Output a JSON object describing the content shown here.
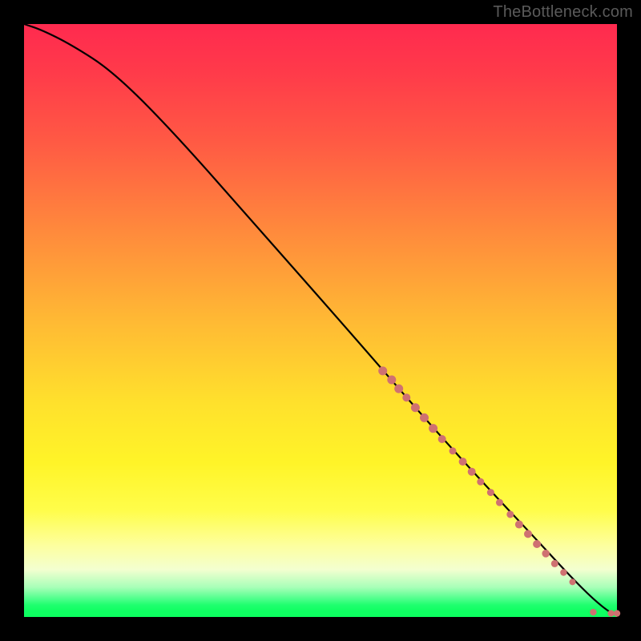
{
  "attribution": "TheBottleneck.com",
  "chart_data": {
    "type": "line",
    "title": "",
    "xlabel": "",
    "ylabel": "",
    "xlim": [
      0,
      100
    ],
    "ylim": [
      0,
      100
    ],
    "line": {
      "x": [
        0,
        3,
        8,
        15,
        25,
        40,
        55,
        68,
        78,
        86,
        92,
        96,
        99,
        100
      ],
      "y": [
        100,
        99,
        96.5,
        92,
        82,
        65,
        48,
        33,
        22,
        13.5,
        7,
        3,
        0.6,
        0.6
      ]
    },
    "markers": [
      {
        "x": 60.5,
        "y": 41.5,
        "r": 5.5
      },
      {
        "x": 62.0,
        "y": 40.0,
        "r": 5.5
      },
      {
        "x": 63.2,
        "y": 38.5,
        "r": 5.5
      },
      {
        "x": 64.5,
        "y": 37.0,
        "r": 5.0
      },
      {
        "x": 66.0,
        "y": 35.3,
        "r": 5.5
      },
      {
        "x": 67.5,
        "y": 33.6,
        "r": 5.5
      },
      {
        "x": 69.0,
        "y": 31.8,
        "r": 5.5
      },
      {
        "x": 70.5,
        "y": 30.0,
        "r": 5.0
      },
      {
        "x": 72.3,
        "y": 28.0,
        "r": 4.5
      },
      {
        "x": 74.0,
        "y": 26.2,
        "r": 5.0
      },
      {
        "x": 75.5,
        "y": 24.5,
        "r": 5.0
      },
      {
        "x": 77.0,
        "y": 22.8,
        "r": 4.5
      },
      {
        "x": 78.7,
        "y": 21.0,
        "r": 4.5
      },
      {
        "x": 80.2,
        "y": 19.3,
        "r": 4.5
      },
      {
        "x": 82.0,
        "y": 17.3,
        "r": 4.5
      },
      {
        "x": 83.5,
        "y": 15.6,
        "r": 5.0
      },
      {
        "x": 85.0,
        "y": 14.0,
        "r": 5.0
      },
      {
        "x": 86.5,
        "y": 12.3,
        "r": 5.0
      },
      {
        "x": 88.0,
        "y": 10.7,
        "r": 4.8
      },
      {
        "x": 89.5,
        "y": 9.0,
        "r": 4.5
      },
      {
        "x": 91.0,
        "y": 7.5,
        "r": 4.2
      },
      {
        "x": 92.5,
        "y": 5.9,
        "r": 4.0
      },
      {
        "x": 96.0,
        "y": 0.8,
        "r": 4.2
      },
      {
        "x": 99.0,
        "y": 0.6,
        "r": 4.2
      },
      {
        "x": 100.0,
        "y": 0.6,
        "r": 4.2
      }
    ]
  }
}
